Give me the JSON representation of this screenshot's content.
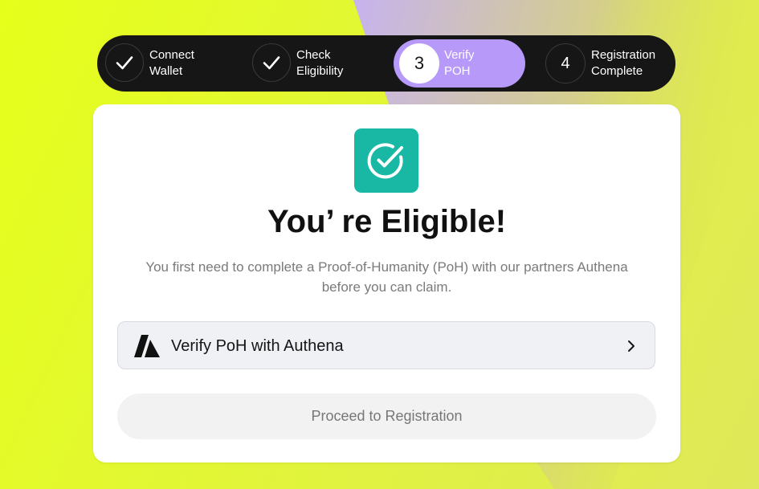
{
  "stepper": {
    "steps": [
      {
        "line1": "Connect",
        "line2": "Wallet",
        "marker": "check-icon",
        "state": "done"
      },
      {
        "line1": "Check",
        "line2": "Eligibility",
        "marker": "check-icon",
        "state": "done"
      },
      {
        "number": "3",
        "line1": "Verify",
        "line2": "POH",
        "state": "active"
      },
      {
        "number": "4",
        "line1": "Registration",
        "line2": "Complete",
        "state": "pending"
      }
    ]
  },
  "card": {
    "badge_icon": "check-circle-icon",
    "title": "You’ re Eligible!",
    "description_line1": "You first need to complete a Proof-of-Humanity (PoH) with our partners Authena",
    "description_line2": "before you can claim.",
    "verify_button": {
      "label": "Verify PoH with Authena",
      "logo_icon": "authena-logo-icon",
      "chevron_icon": "chevron-right-icon"
    },
    "proceed_button": {
      "label": "Proceed to Registration",
      "state": "disabled"
    }
  },
  "colors": {
    "background_yellow": "#e6ff1a",
    "background_lavender": "#c7b3ee",
    "stepper_bg": "#161616",
    "active_step": "#b699f8",
    "badge": "#19b8a5",
    "card": "#ffffff"
  }
}
